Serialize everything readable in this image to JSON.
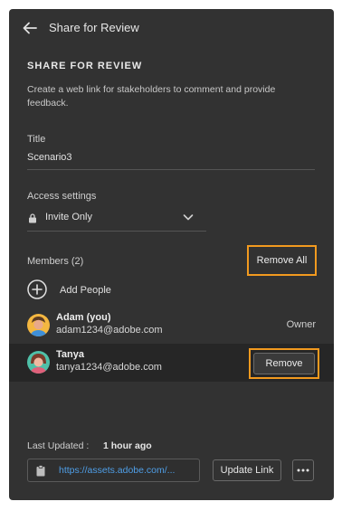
{
  "header": {
    "title": "Share for Review"
  },
  "intro": {
    "heading": "SHARE FOR REVIEW",
    "description": "Create a web link for stakeholders to comment and provide feedback."
  },
  "title_field": {
    "label": "Title",
    "value": "Scenario3"
  },
  "access": {
    "label": "Access settings",
    "value": "Invite Only"
  },
  "members": {
    "label": "Members (2)",
    "remove_all_label": "Remove All",
    "add_label": "Add People",
    "list": [
      {
        "name": "Adam (you)",
        "email": "adam1234@adobe.com",
        "role": "Owner"
      },
      {
        "name": "Tanya",
        "email": "tanya1234@adobe.com",
        "action": "Remove"
      }
    ]
  },
  "footer": {
    "last_updated_label": "Last Updated :",
    "last_updated_value": "1 hour ago",
    "link": "https://assets.adobe.com/...",
    "update_button": "Update Link"
  },
  "colors": {
    "panel_bg": "#323232",
    "highlight_outline": "#f29a1f",
    "link": "#4f9fe8",
    "selected_row_bg": "#262626"
  },
  "icons": [
    "back-arrow-icon",
    "lock-icon",
    "chevron-down-icon",
    "add-circle-icon",
    "clipboard-icon",
    "more-icon"
  ]
}
